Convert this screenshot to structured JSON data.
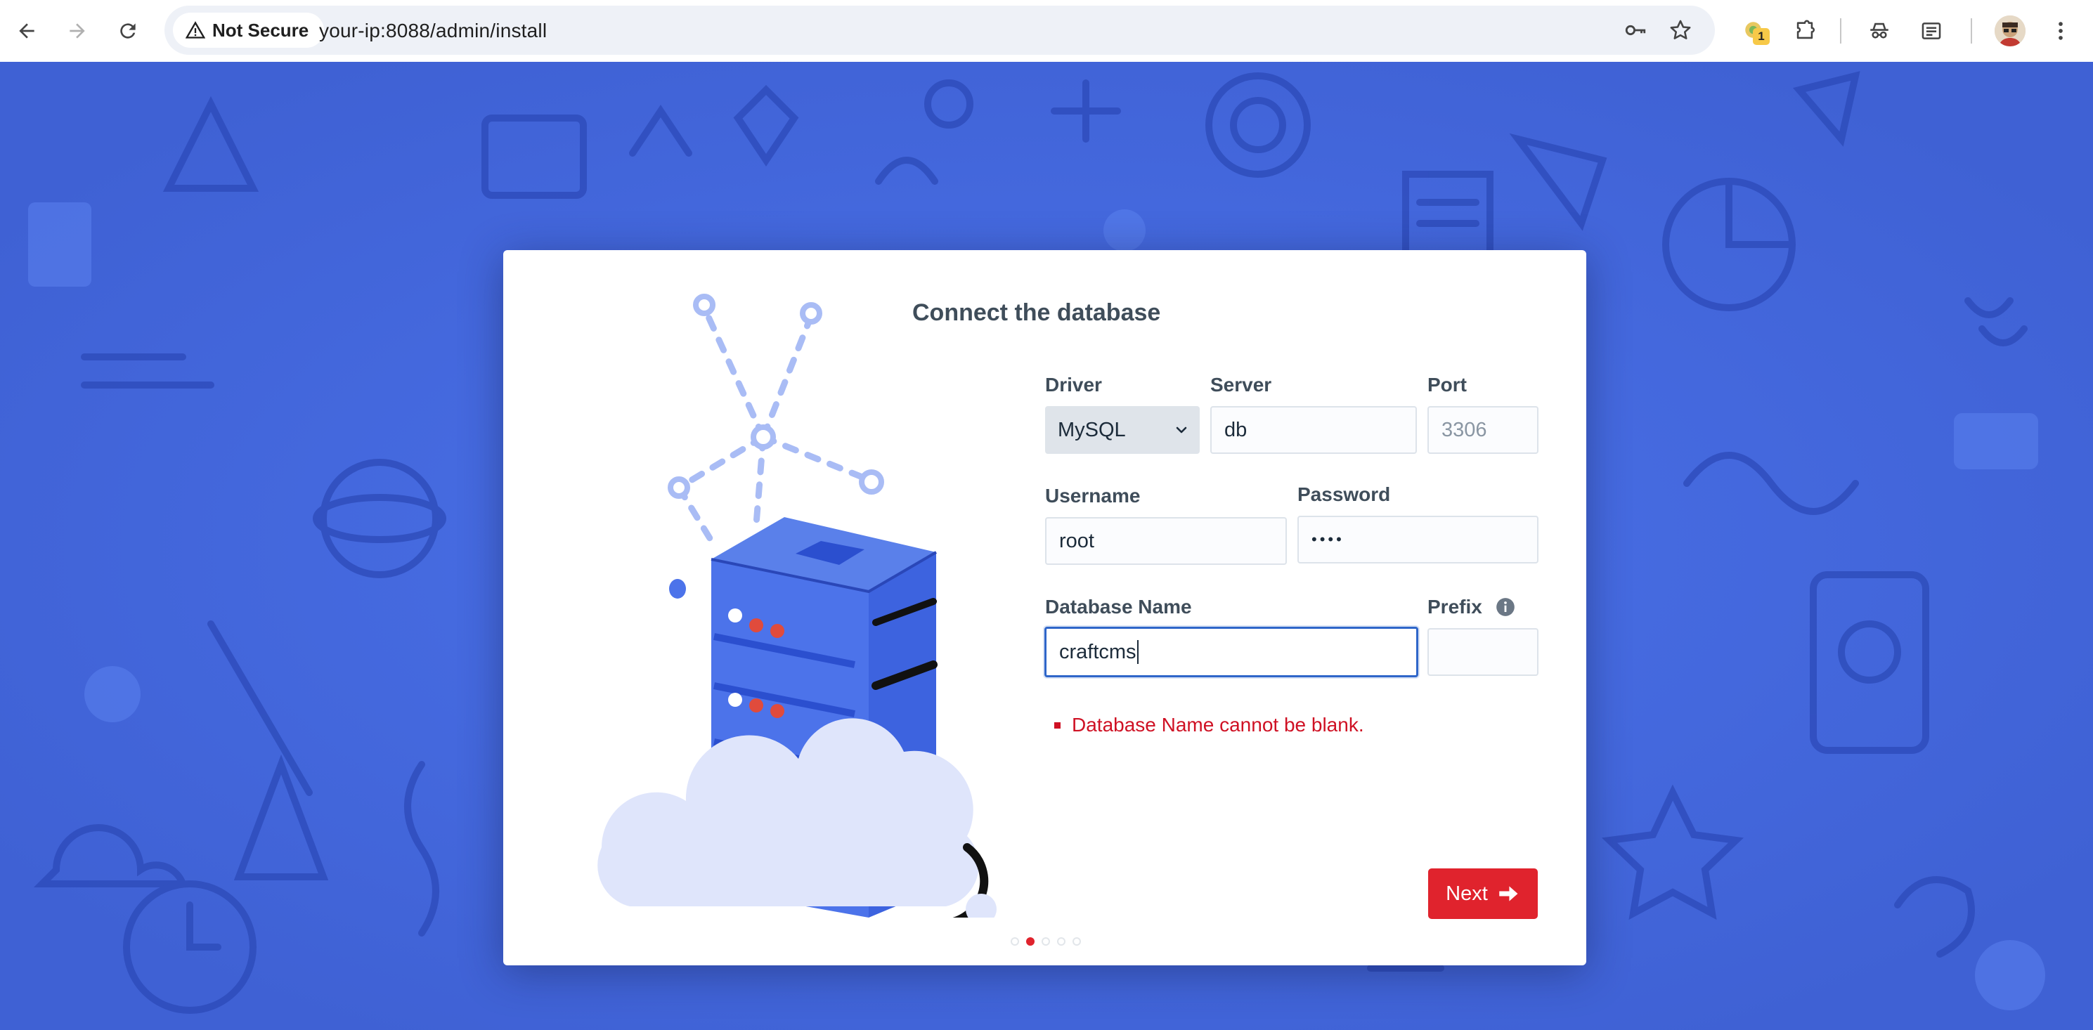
{
  "browser": {
    "security_label": "Not Secure",
    "url": "your-ip:8088/admin/install",
    "extension_badge": "1",
    "icons": [
      "back-arrow-icon",
      "forward-arrow-icon",
      "reload-icon",
      "warning-triangle-icon",
      "key-icon",
      "star-icon",
      "extension-icon",
      "puzzle-icon",
      "incognito-icon",
      "reading-list-icon",
      "avatar",
      "kebab-menu-icon"
    ]
  },
  "install": {
    "title": "Connect the database",
    "fields": {
      "driver": {
        "label": "Driver",
        "value": "MySQL"
      },
      "server": {
        "label": "Server",
        "value": "db"
      },
      "port": {
        "label": "Port",
        "placeholder": "3306"
      },
      "username": {
        "label": "Username",
        "value": "root"
      },
      "password": {
        "label": "Password",
        "value": "••••"
      },
      "database_name": {
        "label": "Database Name",
        "value": "craftcms"
      },
      "prefix": {
        "label": "Prefix",
        "value": ""
      }
    },
    "error": "Database Name cannot be blank.",
    "next_label": "Next",
    "steps": {
      "total": 5,
      "current": 2
    }
  },
  "colors": {
    "background": "#4a6fe3",
    "error": "#cf1124",
    "primary_button": "#e0232d",
    "focus_border": "#2f66c9"
  }
}
